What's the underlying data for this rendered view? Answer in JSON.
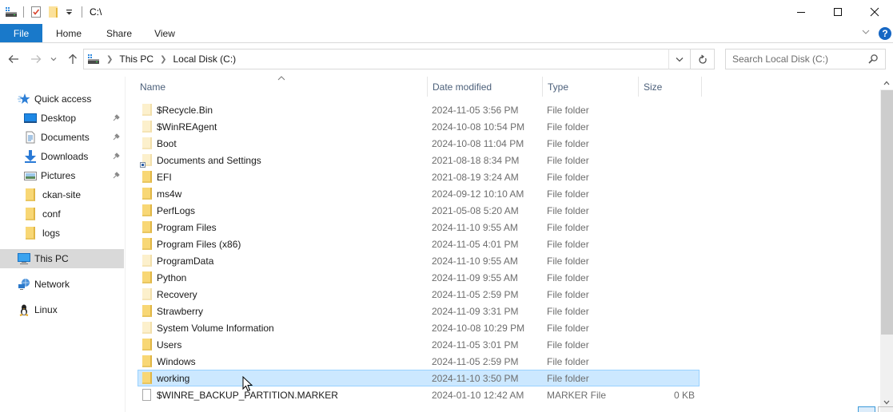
{
  "window": {
    "title": "C:\\",
    "controls": {
      "minimize": "minimize",
      "maximize": "maximize",
      "close": "close"
    }
  },
  "ribbon": {
    "tabs": [
      {
        "label": "File",
        "active": true
      },
      {
        "label": "Home"
      },
      {
        "label": "Share"
      },
      {
        "label": "View"
      }
    ],
    "help_label": "?"
  },
  "address": {
    "crumbs": [
      "This PC",
      "Local Disk (C:)"
    ],
    "search_placeholder": "Search Local Disk (C:)"
  },
  "navpane": {
    "items": [
      {
        "label": "Quick access",
        "icon": "star-icon",
        "level": 0
      },
      {
        "label": "Desktop",
        "icon": "desktop-icon",
        "level": 1,
        "pinned": true
      },
      {
        "label": "Documents",
        "icon": "documents-icon",
        "level": 1,
        "pinned": true
      },
      {
        "label": "Downloads",
        "icon": "download-arrow-icon",
        "level": 1,
        "pinned": true
      },
      {
        "label": "Pictures",
        "icon": "pictures-icon",
        "level": 1,
        "pinned": true
      },
      {
        "label": "ckan-site",
        "icon": "folder-icon",
        "level": 1
      },
      {
        "label": "conf",
        "icon": "folder-icon",
        "level": 1
      },
      {
        "label": "logs",
        "icon": "folder-icon",
        "level": 1
      },
      {
        "label": "This PC",
        "icon": "computer-icon",
        "level": 0,
        "selected": true
      },
      {
        "label": "Network",
        "icon": "network-icon",
        "level": 0
      },
      {
        "label": "Linux",
        "icon": "linux-penguin-icon",
        "level": 0
      }
    ]
  },
  "list": {
    "columns": {
      "name": "Name",
      "date": "Date modified",
      "type": "Type",
      "size": "Size"
    },
    "sorted_by": "Name",
    "rows": [
      {
        "name": "$Recycle.Bin",
        "date": "2024-11-05 3:56 PM",
        "type": "File folder",
        "size": "",
        "icon": "hidden-folder"
      },
      {
        "name": "$WinREAgent",
        "date": "2024-10-08 10:54 PM",
        "type": "File folder",
        "size": "",
        "icon": "hidden-folder"
      },
      {
        "name": "Boot",
        "date": "2024-10-08 11:04 PM",
        "type": "File folder",
        "size": "",
        "icon": "hidden-folder"
      },
      {
        "name": "Documents and Settings",
        "date": "2021-08-18 8:34 PM",
        "type": "File folder",
        "size": "",
        "icon": "shortcut-folder"
      },
      {
        "name": "EFI",
        "date": "2021-08-19 3:24 AM",
        "type": "File folder",
        "size": "",
        "icon": "folder"
      },
      {
        "name": "ms4w",
        "date": "2024-09-12 10:10 AM",
        "type": "File folder",
        "size": "",
        "icon": "folder"
      },
      {
        "name": "PerfLogs",
        "date": "2021-05-08 5:20 AM",
        "type": "File folder",
        "size": "",
        "icon": "folder"
      },
      {
        "name": "Program Files",
        "date": "2024-11-10 9:55 AM",
        "type": "File folder",
        "size": "",
        "icon": "folder"
      },
      {
        "name": "Program Files (x86)",
        "date": "2024-11-05 4:01 PM",
        "type": "File folder",
        "size": "",
        "icon": "folder"
      },
      {
        "name": "ProgramData",
        "date": "2024-11-10 9:55 AM",
        "type": "File folder",
        "size": "",
        "icon": "hidden-folder"
      },
      {
        "name": "Python",
        "date": "2024-11-09 9:55 AM",
        "type": "File folder",
        "size": "",
        "icon": "folder"
      },
      {
        "name": "Recovery",
        "date": "2024-11-05 2:59 PM",
        "type": "File folder",
        "size": "",
        "icon": "hidden-folder"
      },
      {
        "name": "Strawberry",
        "date": "2024-11-09 3:31 PM",
        "type": "File folder",
        "size": "",
        "icon": "folder"
      },
      {
        "name": "System Volume Information",
        "date": "2024-10-08 10:29 PM",
        "type": "File folder",
        "size": "",
        "icon": "hidden-folder"
      },
      {
        "name": "Users",
        "date": "2024-11-05 3:01 PM",
        "type": "File folder",
        "size": "",
        "icon": "folder"
      },
      {
        "name": "Windows",
        "date": "2024-11-05 2:59 PM",
        "type": "File folder",
        "size": "",
        "icon": "folder"
      },
      {
        "name": "working",
        "date": "2024-11-10 3:50 PM",
        "type": "File folder",
        "size": "",
        "icon": "folder",
        "selected": true
      },
      {
        "name": "$WINRE_BACKUP_PARTITION.MARKER",
        "date": "2024-01-10 12:42 AM",
        "type": "MARKER File",
        "size": "0 KB",
        "icon": "file"
      }
    ]
  },
  "colors": {
    "file_tab": "#1979ca",
    "selection_bg": "#cce8ff",
    "selection_border": "#99d1ff",
    "nav_selected": "#d9d9d9",
    "header_text": "#4c607a"
  }
}
